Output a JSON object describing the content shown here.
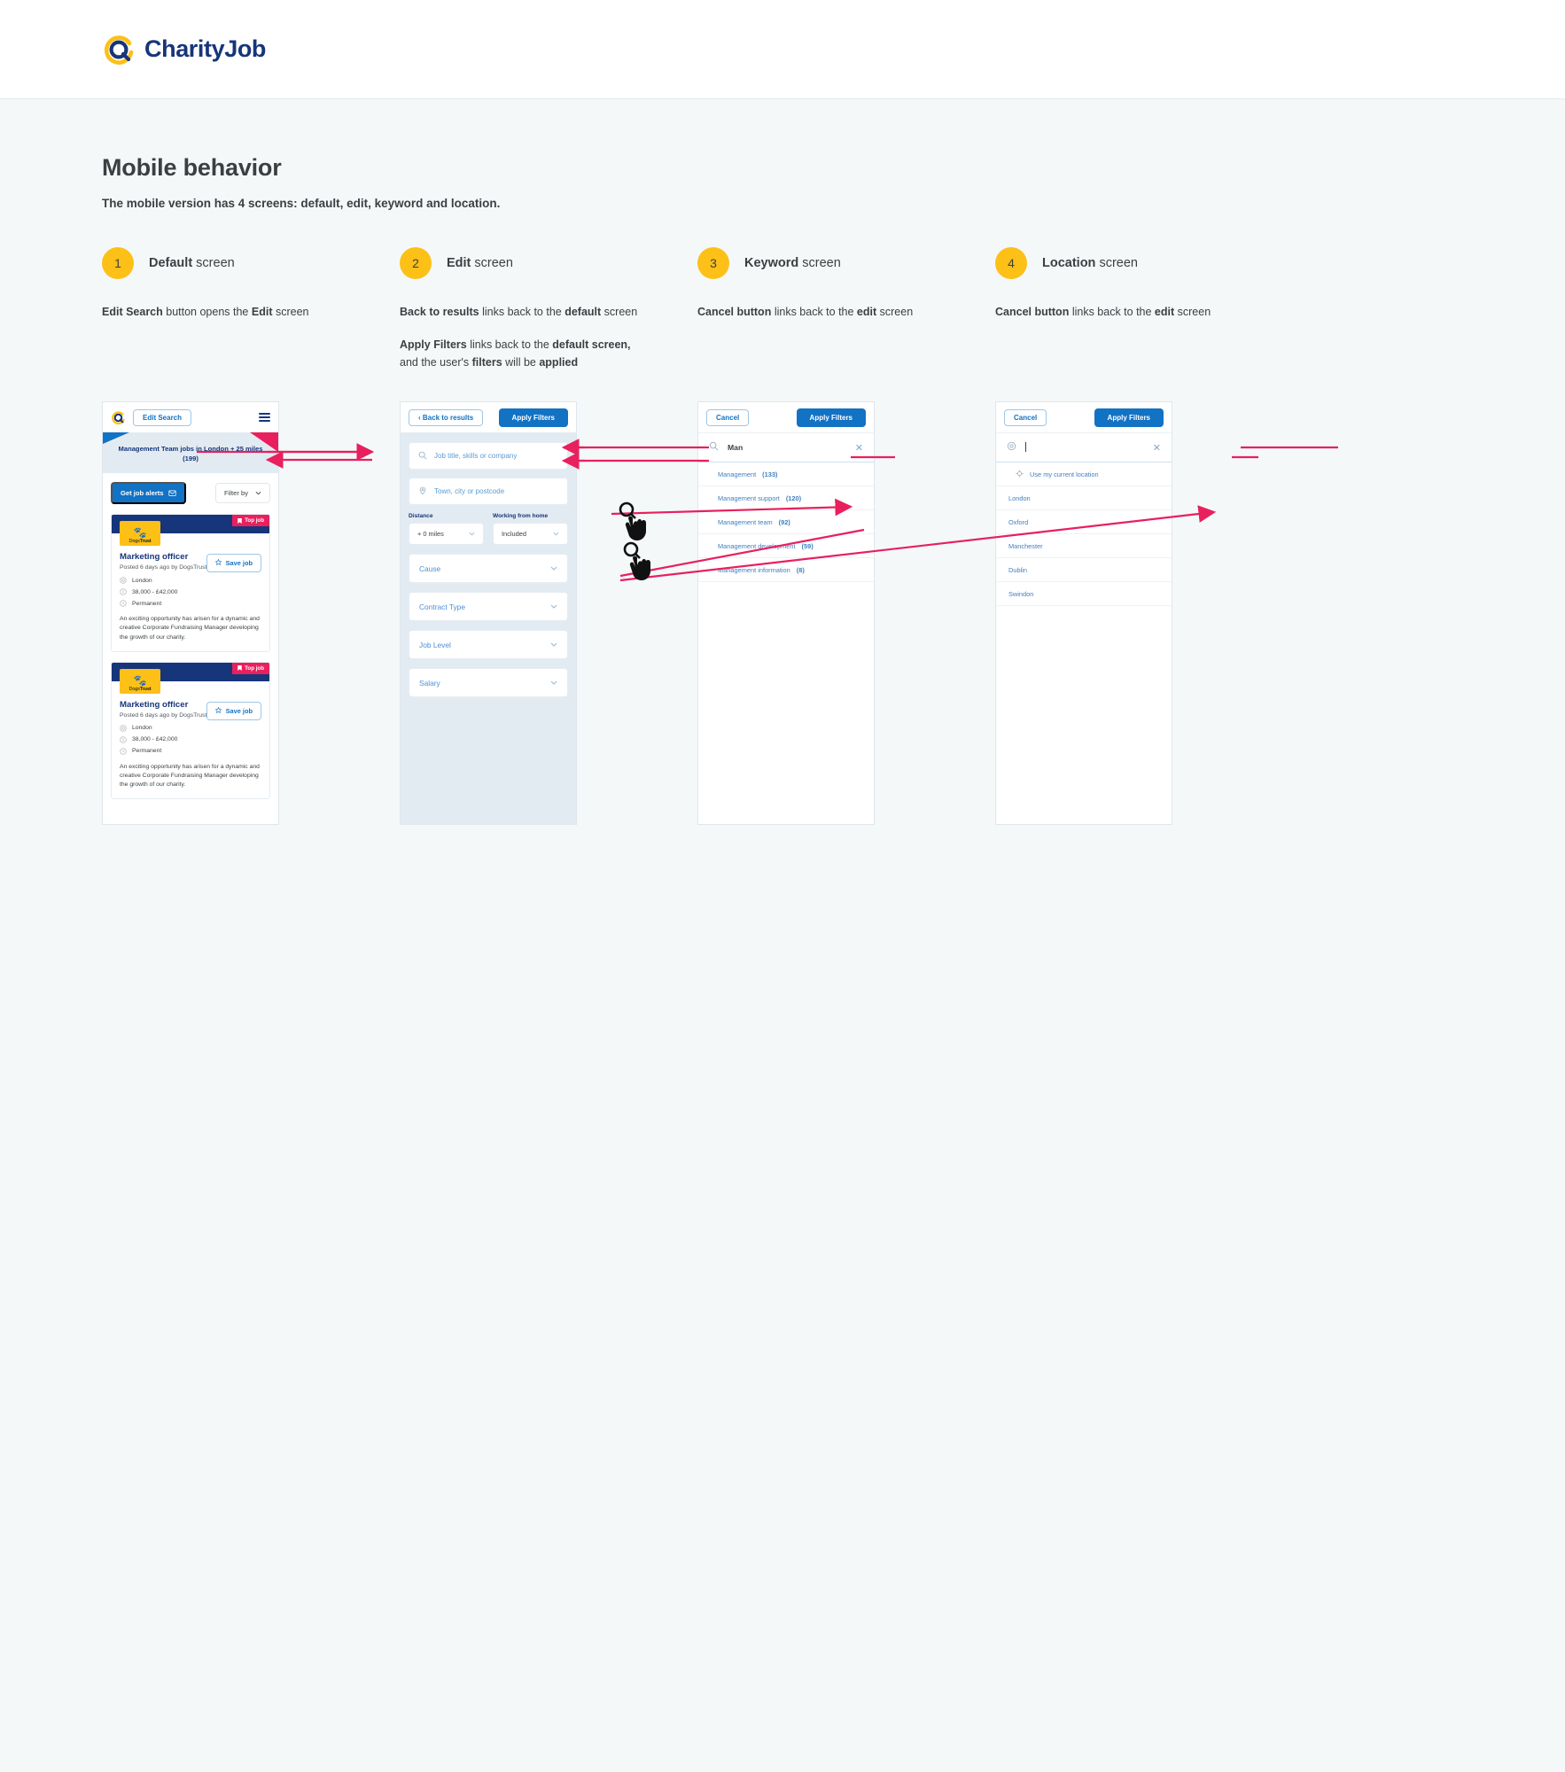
{
  "brand": {
    "name": "CharityJob",
    "logo_icon": "charityjob-logo-icon"
  },
  "page": {
    "title": "Mobile behavior",
    "subtitle": "The mobile version has 4 screens: default, edit, keyword and location."
  },
  "steps": [
    {
      "number": "1",
      "title_bold": "Default",
      "title_rest": " screen",
      "descriptions": [
        {
          "bold1": "Edit Search",
          "mid": " button opens the ",
          "bold2": "Edit",
          "tail": " screen"
        }
      ]
    },
    {
      "number": "2",
      "title_bold": "Edit",
      "title_rest": " screen",
      "descriptions": [
        {
          "bold1": "Back to results",
          "mid": " links back to the ",
          "bold2": "default",
          "tail": " screen"
        },
        {
          "bold1": "Apply Filters",
          "mid": " links back to the ",
          "bold2": "default screen,",
          "tail": ""
        },
        {
          "bold1": "",
          "mid": "and the user's ",
          "bold2": "filters",
          "tail": " will be ",
          "bold3": "applied"
        }
      ]
    },
    {
      "number": "3",
      "title_bold": "Keyword",
      "title_rest": " screen",
      "descriptions": [
        {
          "bold1": "Cancel button",
          "mid": " links back to the ",
          "bold2": "edit",
          "tail": " screen"
        }
      ]
    },
    {
      "number": "4",
      "title_bold": "Location",
      "title_rest": " screen",
      "descriptions": [
        {
          "bold1": "Cancel button",
          "mid": " links back to the ",
          "bold2": "edit",
          "tail": " screen"
        }
      ]
    }
  ],
  "screen_default": {
    "edit_search_button": "Edit Search",
    "menu_icon": "hamburger-menu-icon",
    "banner": "Management Team jobs in London + 25 miles (199)",
    "job_alerts_button": "Get job alerts",
    "filter_by_button": "Filter by",
    "jobs": [
      {
        "badge": "Top job",
        "company_logo": "DogsTrust",
        "company_logo_light": "Dogs",
        "company_logo_bold": "Trust",
        "title": "Marketing officer",
        "posted": "Posted 6 days ago by DogsTrust",
        "location": "London",
        "salary": "38,000 - £42,000",
        "contract": "Permanent",
        "description": "An exciting opportunity has arisen for a dynamic and creative Corporate Fundraising Manager developing the growth of our charity.",
        "save_button": "Save job"
      },
      {
        "badge": "Top job",
        "company_logo": "DogsTrust",
        "company_logo_light": "Dogs",
        "company_logo_bold": "Trust",
        "title": "Marketing officer",
        "posted": "Posted 6 days ago by DogsTrust",
        "location": "London",
        "salary": "38,000 - £42,000",
        "contract": "Permanent",
        "description": "An exciting opportunity has arisen for a dynamic and creative Corporate Fundraising Manager developing the growth of our charity.",
        "save_button": "Save job"
      }
    ]
  },
  "screen_edit": {
    "back_button": "Back to results",
    "apply_button": "Apply Filters",
    "keyword_placeholder": "Job title, skills or company",
    "location_placeholder": "Town, city or postcode",
    "distance_label": "Distance",
    "distance_value": "+ 0 miles",
    "working_label": "Working from home",
    "working_value": "Included",
    "accordions": [
      "Cause",
      "Contract Type",
      "Job Level",
      "Salary"
    ]
  },
  "screen_keyword": {
    "cancel_button": "Cancel",
    "apply_button": "Apply Filters",
    "search_value": "Man",
    "clear_icon": "close-icon",
    "suggestions": [
      {
        "label": "Management",
        "count": "(133)"
      },
      {
        "label": "Management support",
        "count": "(120)"
      },
      {
        "label": "Management team",
        "count": "(92)"
      },
      {
        "label": "Management development",
        "count": "(59)"
      },
      {
        "label": "Management information",
        "count": "(8)"
      }
    ]
  },
  "screen_location": {
    "cancel_button": "Cancel",
    "apply_button": "Apply Filters",
    "search_value": "",
    "clear_icon": "close-icon",
    "current_location": "Use my current location",
    "suggestions": [
      "London",
      "Oxford",
      "Manchester",
      "Dublin",
      "Swindon"
    ]
  },
  "colors": {
    "accent_yellow": "#fcc017",
    "brand_navy": "#16357a",
    "primary_blue": "#1272c4",
    "arrow_pink": "#e8205e",
    "page_bg": "#f4f8f9"
  }
}
